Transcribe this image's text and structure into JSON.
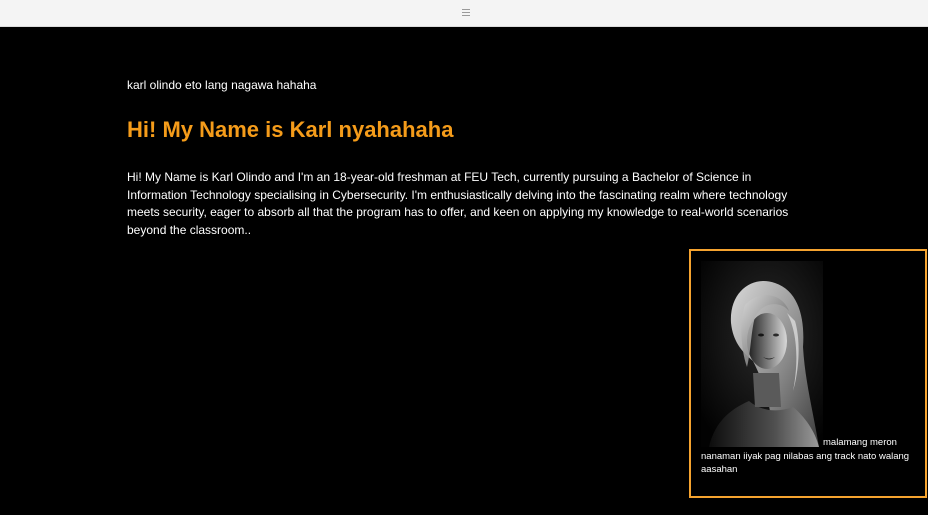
{
  "topbar": {
    "menu_icon": "hamburger-menu-icon"
  },
  "main": {
    "tagline": "karl olindo eto lang nagawa hahaha",
    "heading": "Hi! My Name is Karl nyahahaha",
    "intro": "Hi! My Name is Karl Olindo and I'm an 18-year-old freshman at FEU Tech, currently pursuing a Bachelor of Science in Information Technology specialising in Cybersecurity. I'm enthusiastically delving into the fascinating realm where technology meets security, eager to absorb all that the program has to offer, and keen on applying my knowledge to real-world scenarios beyond the classroom.."
  },
  "photo_card": {
    "caption": "malamang meron nanaman iiyak pag nilabas ang track nato walang aasahan"
  },
  "colors": {
    "background": "#000000",
    "accent": "#f59c1a",
    "card_border": "#f5a32f",
    "topbar": "#f4f4f4"
  }
}
